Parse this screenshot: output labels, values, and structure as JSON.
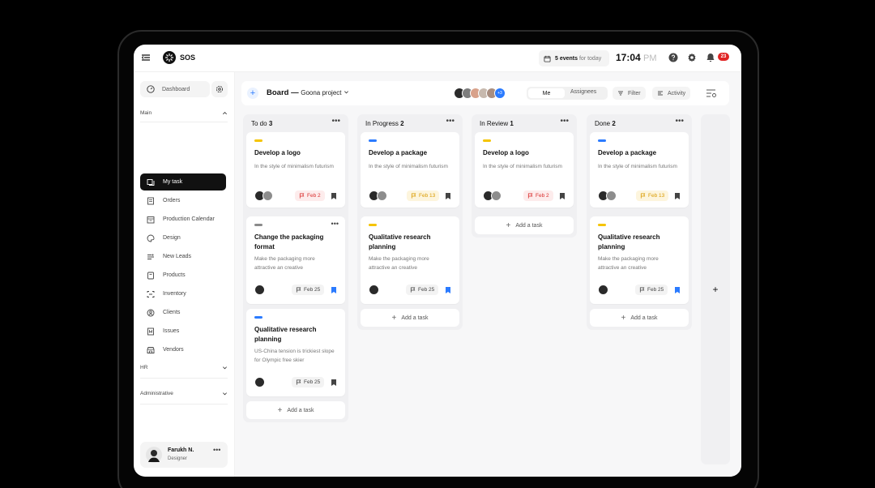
{
  "app": {
    "name": "SOS"
  },
  "topbar": {
    "events_count": "5 events",
    "events_suffix": "for today",
    "time": "17:04",
    "time_suffix": "PM",
    "notifications": "23"
  },
  "sidebar": {
    "dashboard": "Dashboard",
    "section_main": "Main",
    "section_hr": "HR",
    "section_admin": "Administrative",
    "items": [
      {
        "label": "My task",
        "icon": "task-icon"
      },
      {
        "label": "Orders",
        "icon": "orders-icon"
      },
      {
        "label": "Production Calendar",
        "icon": "calendar-icon"
      },
      {
        "label": "Design",
        "icon": "palette-icon"
      },
      {
        "label": "New Leads",
        "icon": "leads-icon"
      },
      {
        "label": "Products",
        "icon": "box-icon"
      },
      {
        "label": "Inventory",
        "icon": "inventory-icon"
      },
      {
        "label": "Clients",
        "icon": "clients-icon"
      },
      {
        "label": "Issues",
        "icon": "issues-icon"
      },
      {
        "label": "Vendors",
        "icon": "store-icon"
      }
    ],
    "user": {
      "name": "Farukh N.",
      "role": "Designer"
    }
  },
  "board": {
    "title": "Board —",
    "project": "Goona project",
    "extra_members": "+3",
    "view_me": "Me",
    "view_assignees": "Assignees",
    "filter": "Filter",
    "activity": "Activity",
    "add_task": "Add a task"
  },
  "columns": [
    {
      "name": "To do",
      "count": "3",
      "cards": [
        {
          "tag": "#f5c400",
          "title": "Develop a logo",
          "desc": "In the style of minimalism futurism",
          "date": "Feb 2",
          "date_style": "red",
          "bookmarked": false,
          "menu": false
        },
        {
          "tag": "#8a8a8a",
          "title": "Change the packaging format",
          "desc": "Make the packaging more attractive an creative",
          "date": "Feb 25",
          "date_style": "gray",
          "bookmarked": true,
          "menu": true
        },
        {
          "tag": "#2b7bff",
          "title": "Qualitative research planning",
          "desc": "US-China tension is trickiest slope for Olympic free skier",
          "date": "Feb 25",
          "date_style": "gray",
          "bookmarked": false,
          "menu": false
        }
      ]
    },
    {
      "name": "In Progress",
      "count": "2",
      "cards": [
        {
          "tag": "#2b7bff",
          "title": "Develop a package",
          "desc": "In the style of minimalism futurism",
          "date": "Feb 13",
          "date_style": "yellow",
          "bookmarked": false,
          "menu": false
        },
        {
          "tag": "#f5c400",
          "title": "Qualitative research planning",
          "desc": "Make the packaging more attractive an creative",
          "date": "Feb 25",
          "date_style": "gray",
          "bookmarked": true,
          "menu": false
        }
      ]
    },
    {
      "name": "In Review",
      "count": "1",
      "cards": [
        {
          "tag": "#f5c400",
          "title": "Develop a logo",
          "desc": "In the style of minimalism futurism",
          "date": "Feb 2",
          "date_style": "red",
          "bookmarked": false,
          "menu": false
        }
      ]
    },
    {
      "name": "Done",
      "count": "2",
      "cards": [
        {
          "tag": "#2b7bff",
          "title": "Develop a package",
          "desc": "In the style of minimalism futurism",
          "date": "Feb 13",
          "date_style": "yellow",
          "bookmarked": false,
          "menu": false
        },
        {
          "tag": "#f5c400",
          "title": "Qualitative research planning",
          "desc": "Make the packaging more attractive an creative",
          "date": "Feb 25",
          "date_style": "gray",
          "bookmarked": true,
          "menu": false
        }
      ]
    }
  ],
  "colors": {
    "accent": "#2b7bff",
    "active_nav": "#111111",
    "badge": "#e02424"
  }
}
